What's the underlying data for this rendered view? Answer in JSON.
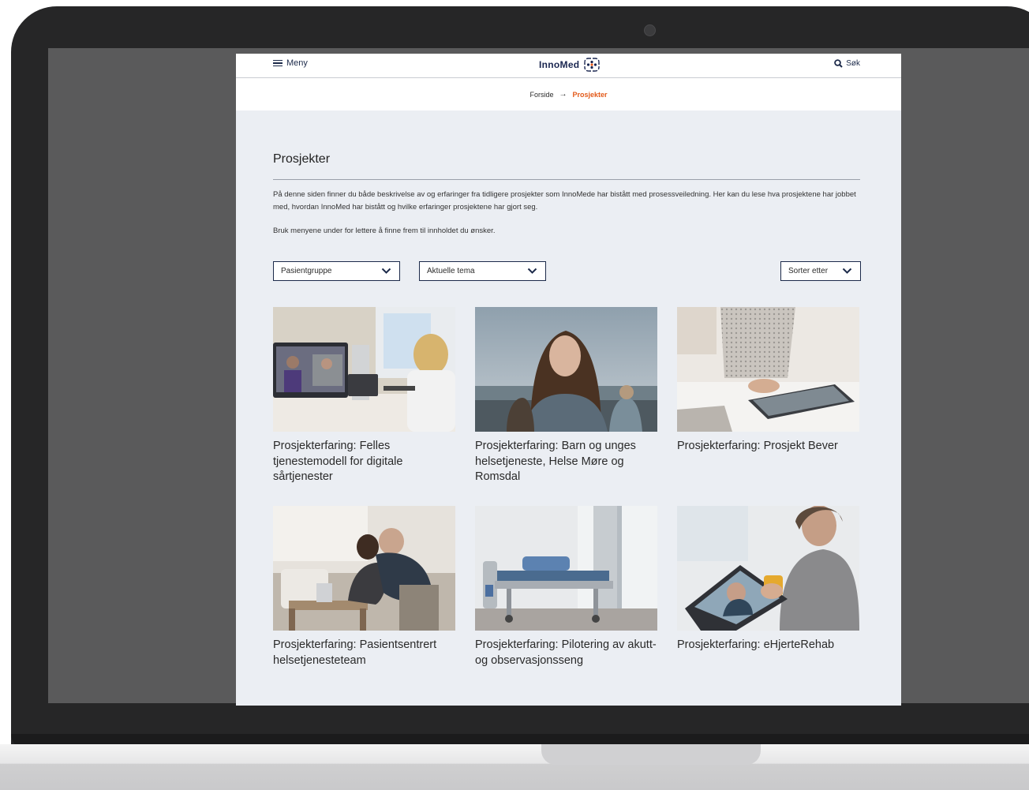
{
  "header": {
    "menu_label": "Meny",
    "logo_text": "InnoMed",
    "search_label": "Søk"
  },
  "breadcrumb": {
    "home": "Forside",
    "separator": "→",
    "current": "Prosjekter"
  },
  "main": {
    "title": "Prosjekter",
    "intro": "På denne siden finner du både beskrivelse av og erfaringer fra tidligere prosjekter som InnoMede har bistått med prosessveiledning. Her kan du lese hva prosjektene har jobbet med, hvordan InnoMed har bistått og hvilke erfaringer prosjektene har gjort seg.",
    "intro2": "Bruk menyene under for lettere å finne frem til innholdet du ønsker."
  },
  "filters": {
    "patient_group": "Pasientgruppe",
    "current_topics": "Aktuelle tema",
    "sort_by": "Sorter etter"
  },
  "projects": [
    {
      "title": "Prosjekterfaring: Felles tjenestemodell for digitale sårtjenester"
    },
    {
      "title": "Prosjekterfaring: Barn og unges helsetjeneste, Helse Møre og Romsdal"
    },
    {
      "title": "Prosjekterfaring: Prosjekt Bever"
    },
    {
      "title": "Prosjekterfaring: Pasientsentrert helsetjenesteteam"
    },
    {
      "title": "Prosjekterfaring: Pilotering av akutt- og observasjonsseng"
    },
    {
      "title": "Prosjekterfaring: eHjerteRehab"
    }
  ],
  "colors": {
    "accent": "#e35a1a",
    "brand_navy": "#1a2650",
    "page_bg": "#ebeef3"
  }
}
